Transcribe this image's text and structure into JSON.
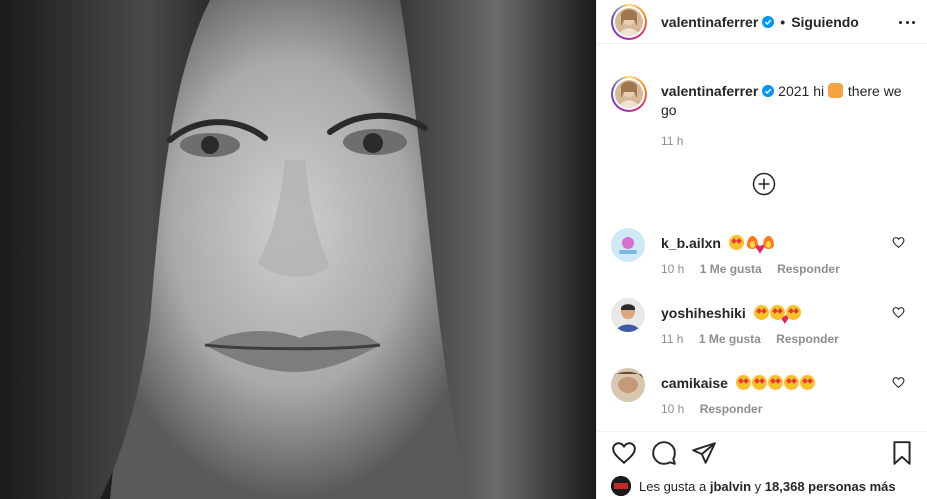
{
  "post_author": {
    "username": "valentinaferrer",
    "follow_status": "Siguiendo",
    "separator": "•"
  },
  "caption": {
    "username": "valentinaferrer",
    "text_before": "2021 hi",
    "text_after": "there we go",
    "time": "11 h"
  },
  "comments": [
    {
      "username": "k_b.ailxn",
      "emojis": [
        "star",
        "fire",
        "fire",
        "heart"
      ],
      "time": "10 h",
      "likes": "1 Me gusta",
      "reply": "Responder"
    },
    {
      "username": "yoshiheshiki",
      "emojis": [
        "heart",
        "heart",
        "heart",
        "star",
        "star",
        "star"
      ],
      "time": "11 h",
      "likes": "1 Me gusta",
      "reply": "Responder"
    },
    {
      "username": "camikaise",
      "emojis": [
        "star",
        "star",
        "star",
        "star",
        "star"
      ],
      "time": "10 h",
      "likes": "",
      "reply": "Responder"
    }
  ],
  "likes_line": {
    "prefix": "Les gusta a",
    "user": "jbalvin",
    "joiner": "y",
    "others": "18,368 personas más"
  },
  "icons": {
    "verified": "verified-badge-icon",
    "more": "more-options-icon",
    "add": "plus-circle-icon",
    "like": "heart-outline-icon",
    "comment": "comment-bubble-icon",
    "share": "paper-plane-icon",
    "save": "bookmark-icon"
  },
  "colors": {
    "verified": "#0095f6",
    "meta": "#8e8e8e",
    "text": "#262626"
  }
}
